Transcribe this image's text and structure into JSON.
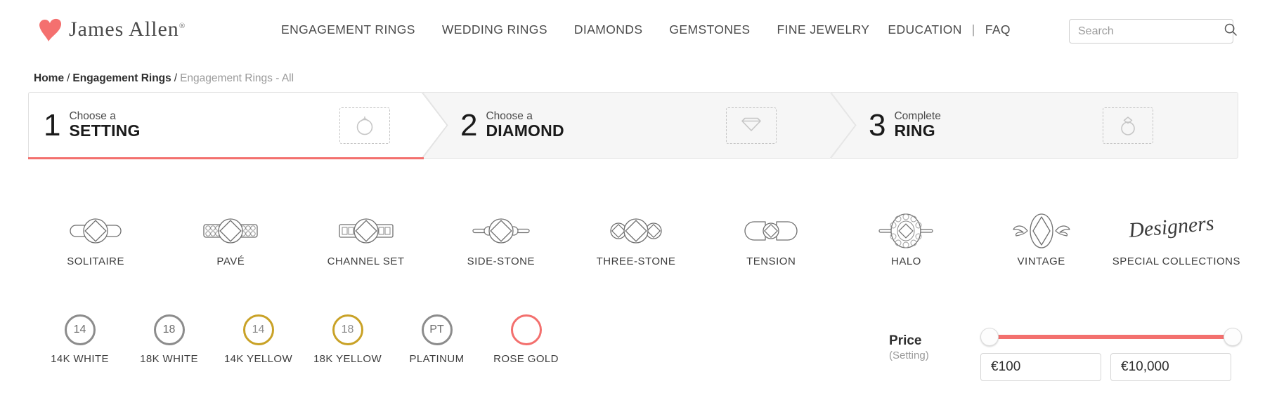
{
  "brand": {
    "name": "James Allen",
    "registered_mark": "®",
    "heart_color": "#f4706f"
  },
  "header": {
    "nav": [
      {
        "label": "ENGAGEMENT RINGS"
      },
      {
        "label": "WEDDING RINGS"
      },
      {
        "label": "DIAMONDS"
      },
      {
        "label": "GEMSTONES"
      },
      {
        "label": "FINE JEWELRY"
      },
      {
        "label": "EDUCATION"
      },
      {
        "label": "FAQ"
      }
    ],
    "nav_separator": "|",
    "search": {
      "placeholder": "Search",
      "value": ""
    }
  },
  "breadcrumb": {
    "home": "Home",
    "sep1": "/",
    "category": "Engagement Rings",
    "sep2": "/",
    "current": "Engagement Rings - All"
  },
  "steps": [
    {
      "number": "1",
      "sub": "Choose a",
      "main": "SETTING",
      "icon": "ring-band-icon",
      "active": true
    },
    {
      "number": "2",
      "sub": "Choose a",
      "main": "DIAMOND",
      "icon": "diamond-icon",
      "active": false
    },
    {
      "number": "3",
      "sub": "Complete",
      "main": "RING",
      "icon": "complete-ring-icon",
      "active": false
    }
  ],
  "active_accent": "#f3706e",
  "styles": [
    {
      "label": "SOLITAIRE",
      "icon": "solitaire-ring-icon"
    },
    {
      "label": "PAVÉ",
      "icon": "pave-ring-icon"
    },
    {
      "label": "CHANNEL SET",
      "icon": "channel-set-ring-icon"
    },
    {
      "label": "SIDE-STONE",
      "icon": "side-stone-ring-icon"
    },
    {
      "label": "THREE-STONE",
      "icon": "three-stone-ring-icon"
    },
    {
      "label": "TENSION",
      "icon": "tension-ring-icon"
    },
    {
      "label": "HALO",
      "icon": "halo-ring-icon"
    },
    {
      "label": "VINTAGE",
      "icon": "vintage-ring-icon"
    },
    {
      "label": "SPECIAL COLLECTIONS",
      "icon": "designers-script-icon"
    }
  ],
  "metals": [
    {
      "badge": "14",
      "label": "14K WHITE",
      "tone": "white"
    },
    {
      "badge": "18",
      "label": "18K WHITE",
      "tone": "white"
    },
    {
      "badge": "14",
      "label": "14K YELLOW",
      "tone": "gold"
    },
    {
      "badge": "18",
      "label": "18K YELLOW",
      "tone": "gold"
    },
    {
      "badge": "PT",
      "label": "PLATINUM",
      "tone": "white"
    },
    {
      "badge": "",
      "label": "ROSE GOLD",
      "tone": "rose"
    }
  ],
  "price": {
    "title": "Price",
    "subtitle": "(Setting)",
    "min_value": "€100",
    "max_value": "€10,000",
    "track_color": "#f3706e"
  }
}
